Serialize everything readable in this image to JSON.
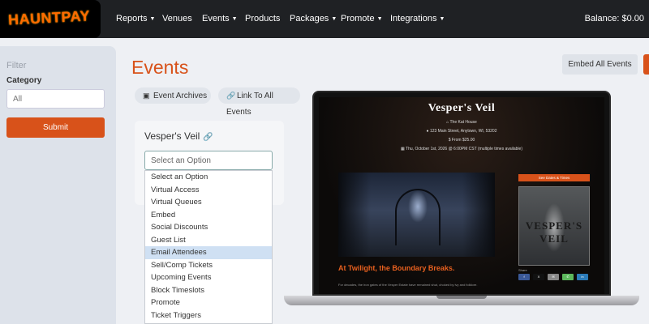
{
  "brand": {
    "logo_text": "HAUNTPAY"
  },
  "nav": {
    "items": [
      {
        "label": "Reports",
        "has_caret": true
      },
      {
        "label": "Venues",
        "has_caret": false
      },
      {
        "label": "Events",
        "has_caret": true
      },
      {
        "label": "Products",
        "has_caret": false
      },
      {
        "label": "Packages",
        "has_caret": true
      },
      {
        "label": "Promote",
        "has_caret": true
      },
      {
        "label": "Integrations",
        "has_caret": true
      }
    ],
    "balance": "Balance: $0.00"
  },
  "sidebar": {
    "filter_title": "Filter",
    "category_label": "Category",
    "category_value": "All",
    "submit_label": "Submit"
  },
  "main": {
    "title": "Events",
    "embed_button": "Embed All Events",
    "pills": [
      {
        "label": "Event Archives",
        "icon": "archive-icon"
      },
      {
        "label": "Link To All Events",
        "icon": "link-icon"
      }
    ],
    "card": {
      "title": "Vesper's Veil",
      "select_placeholder": "Select an Option",
      "options": [
        "Select an Option",
        "Virtual Access",
        "Virtual Queues",
        "Embed",
        "Social Discounts",
        "Guest List",
        "Email Attendees",
        "Sell/Comp Tickets",
        "Upcoming Events",
        "Block Timeslots",
        "Promote",
        "Ticket Triggers"
      ],
      "highlighted_option": "Email Attendees"
    }
  },
  "preview": {
    "title": "Vesper's Veil",
    "venue": "The Kat House",
    "address": "123 Main Street, Anytown, WI, 53202",
    "price": "From $25.00",
    "datetime": "Thu, October 1st, 2026 @ 6:00PM CST (multiple times available)",
    "tagline": "At Twilight, the Boundary Breaks.",
    "body": "For decades, the iron gates of the Vesper Estate have remained shut, choked by ivy and folklore.",
    "see_dates_button": "See Dates & Times",
    "poster_text": "VESPER'S VEIL",
    "share_label": "Share",
    "share_buttons": [
      "f",
      "X",
      "✉",
      "✆",
      "in"
    ]
  },
  "colors": {
    "accent": "#d8521a",
    "nav_bg": "#1f2124",
    "highlight": "#cfe0f3"
  }
}
